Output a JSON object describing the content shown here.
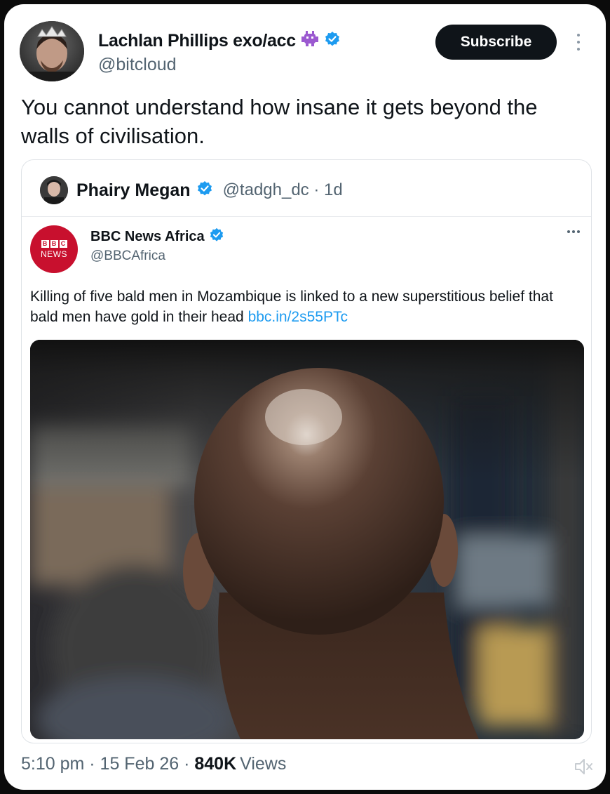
{
  "tweet": {
    "author_name": "Lachlan Phillips exo/acc",
    "author_handle": "@bitcloud",
    "subscribe_label": "Subscribe",
    "text": "You cannot understand how insane it gets beyond the walls of civilisation.",
    "timestamp": "5:10 pm · 15 Feb 26 ·",
    "views_count": "840K",
    "views_label": "Views"
  },
  "quote": {
    "author_name": "Phairy Megan",
    "author_meta": "@tadgh_dc · 1d"
  },
  "embedded": {
    "author_name": "BBC News Africa",
    "author_handle": "@BBCAfrica",
    "avatar_letters": [
      "B",
      "B",
      "C"
    ],
    "avatar_sub": "NEWS",
    "text": "Killing of five bald men in Mozambique is linked to a new superstitious belief that bald men have gold in their head",
    "link": "bbc.in/2s55PTc"
  },
  "colors": {
    "verified": "#1d9bf0",
    "link": "#1d9bf0",
    "bbc_red": "#c8102e",
    "emoji_purple": "#9b59d0"
  },
  "icons": [
    "verified-badge-icon",
    "alien-emoji-icon",
    "more-vertical-icon",
    "more-horizontal-icon",
    "muted-speaker-icon"
  ]
}
